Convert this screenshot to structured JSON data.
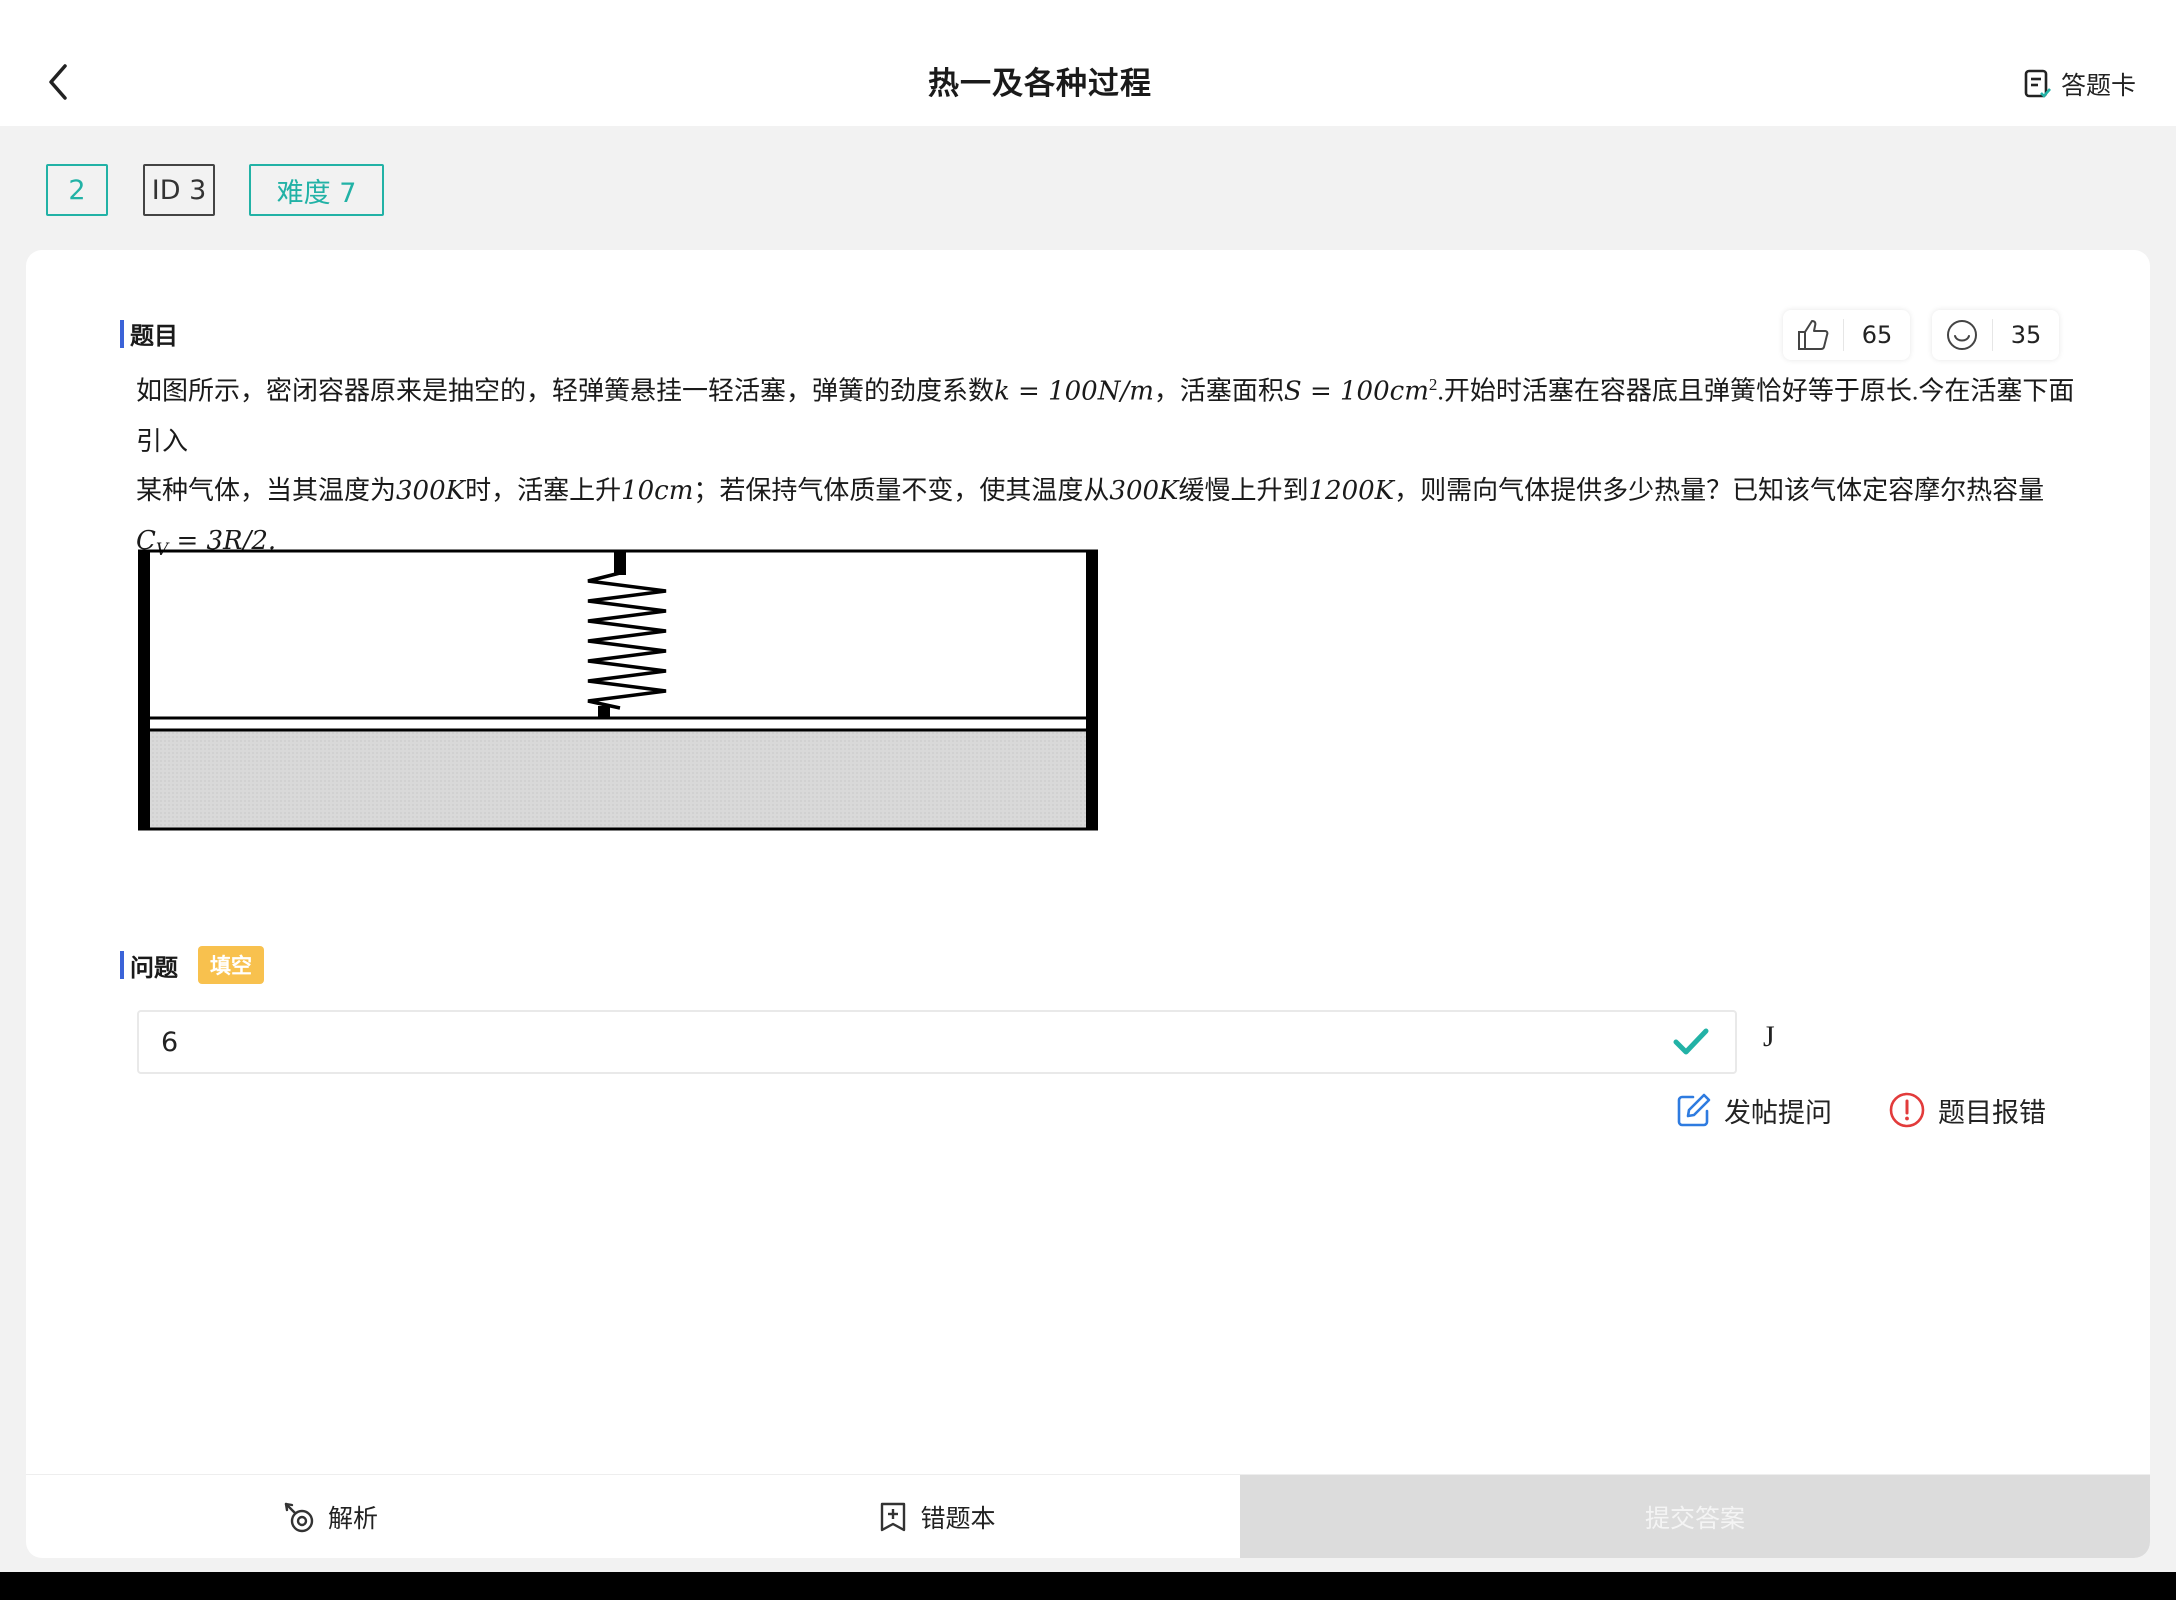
{
  "header": {
    "title": "热一及各种过程",
    "answer_card_label": "答题卡"
  },
  "tags": {
    "number": "2",
    "id": "ID 3",
    "difficulty": "难度 7"
  },
  "question": {
    "section_label": "题目",
    "likes": "65",
    "faces": "35",
    "line1_a": "如图所示，密闭容器原来是抽空的，轻弹簧悬挂一轻活塞，弹簧的劲度系数",
    "line1_k": "k = 100N/m",
    "line1_b": "，活塞面积",
    "line1_s": "S = 100cm",
    "line1_sup": "2",
    "line1_c": ".开始时活塞在容器底且弹簧恰好等于原长.今在活塞下面引入",
    "line2_a": "某种气体，当其温度为",
    "line2_t1": "300K",
    "line2_b": "时，活塞上升",
    "line2_h": "10cm",
    "line2_c": "；若保持气体质量不变，使其温度从",
    "line2_t2": "300K",
    "line2_d": "缓慢上升到",
    "line2_t3": "1200K",
    "line2_e": "，则需向气体提供多少热量？已知该气体定容摩尔热容量",
    "line3": "C",
    "line3_sub": "V",
    "line3_rest": " = 3R/2."
  },
  "problem": {
    "section_label": "问题",
    "type_tag": "填空",
    "answer_value": "6",
    "unit": "J",
    "post_question_label": "发帖提问",
    "report_error_label": "题目报错"
  },
  "bottom_bar": {
    "analysis_label": "解析",
    "wrong_book_label": "错题本",
    "submit_label": "提交答案"
  },
  "colors": {
    "accent_teal": "#22b2a6",
    "section_bar_blue": "#3b63d8",
    "fill_tag_yellow": "#f8c14e",
    "link_blue": "#2e7be0",
    "error_red": "#e23b3b",
    "submit_disabled": "#dcdcdc"
  }
}
